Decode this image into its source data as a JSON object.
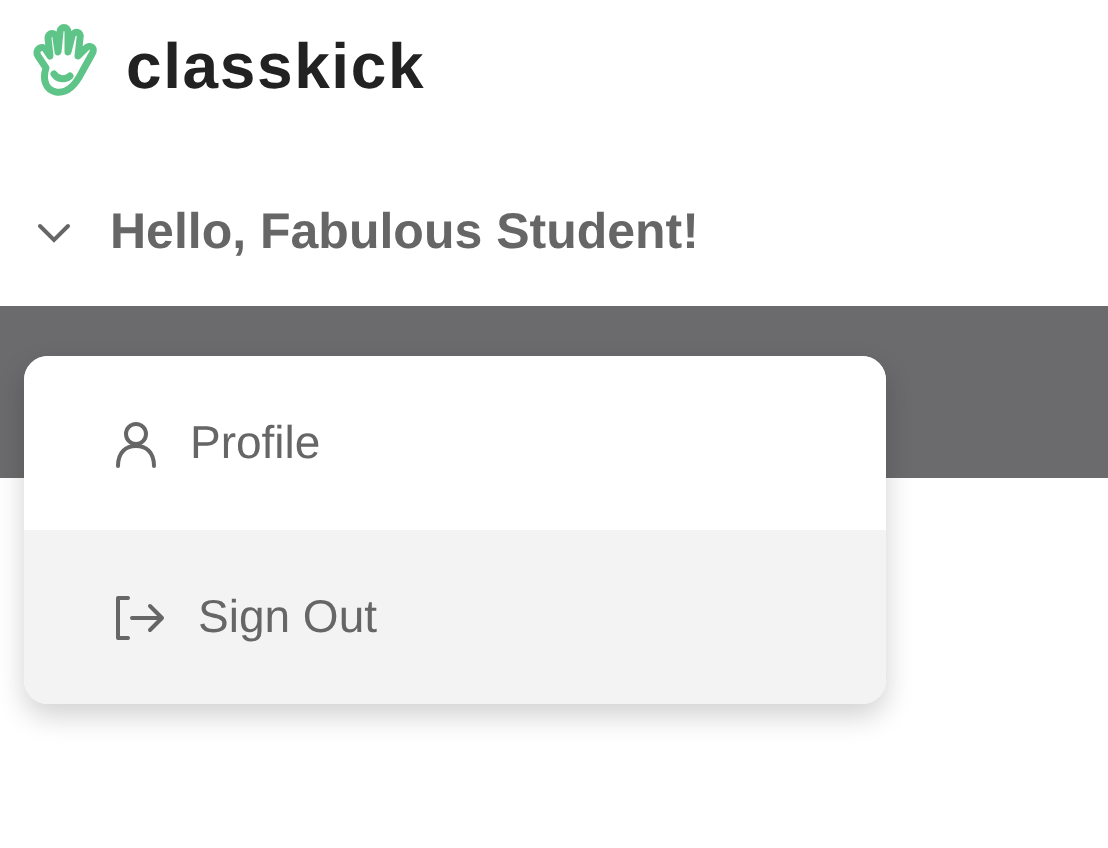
{
  "brand": {
    "name": "classkick"
  },
  "user_menu": {
    "greeting": "Hello, Fabulous Student!",
    "expanded": true,
    "items": [
      {
        "kind": "profile",
        "label": "Profile",
        "selected": false
      },
      {
        "kind": "sign_out",
        "label": "Sign Out",
        "selected": true
      }
    ]
  }
}
